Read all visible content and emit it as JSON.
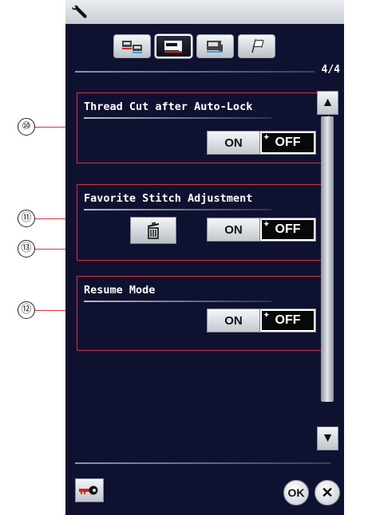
{
  "callouts": [
    {
      "number": "⑩",
      "target": "thread-cut-section"
    },
    {
      "number": "⑪",
      "target": "favorite-stitch-section"
    },
    {
      "number": "⑬",
      "target": "delete-favorite-button"
    },
    {
      "number": "⑫",
      "target": "resume-mode-section"
    }
  ],
  "header": {
    "icon": "wrench-icon"
  },
  "tabs": [
    {
      "name": "common-settings",
      "icon": "machine-pair-icon",
      "active": false
    },
    {
      "name": "ordinary-sewing-settings",
      "icon": "sewing-machine-icon",
      "active": true
    },
    {
      "name": "embroidery-settings",
      "icon": "embroidery-machine-icon",
      "active": false
    },
    {
      "name": "language-settings",
      "icon": "flag-icon",
      "active": false
    }
  ],
  "page_indicator": "4/4",
  "settings": [
    {
      "label": "Thread Cut after Auto-Lock",
      "on_label": "ON",
      "off_label": "OFF",
      "selected": "OFF"
    },
    {
      "label": "Favorite Stitch Adjustment",
      "on_label": "ON",
      "off_label": "OFF",
      "selected": "OFF",
      "has_delete_button": true
    },
    {
      "label": "Resume Mode",
      "on_label": "ON",
      "off_label": "OFF",
      "selected": "OFF"
    }
  ],
  "scrollbar": {
    "up_icon": "▲",
    "down_icon": "▼"
  },
  "footer": {
    "key_icon": "key-icon",
    "ok_label": "OK",
    "cancel_label": "✕"
  }
}
